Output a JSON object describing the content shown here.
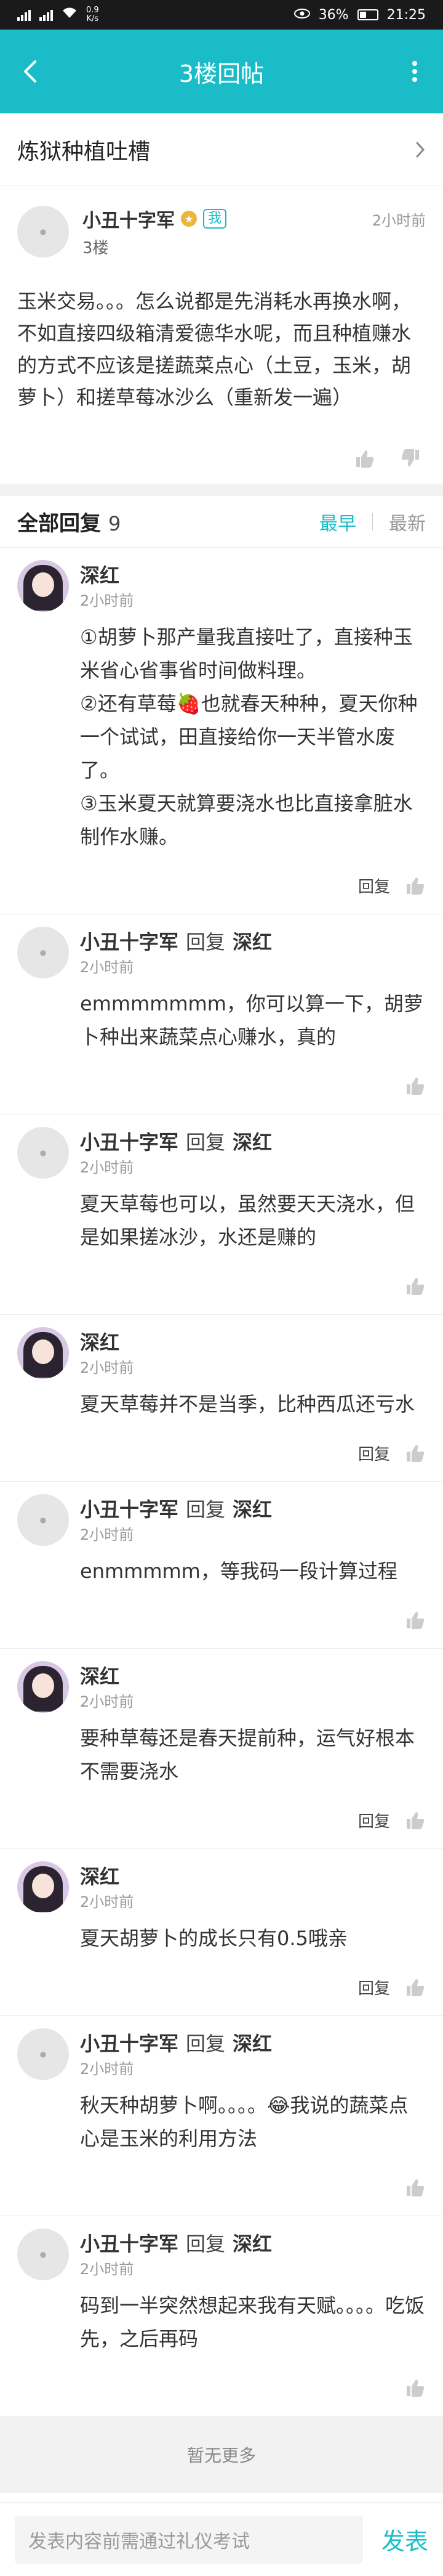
{
  "status_bar": {
    "net_speed": "0.9\nK/s",
    "battery": "36%",
    "time": "21:25"
  },
  "header": {
    "title": "3楼回帖"
  },
  "thread": {
    "title": "炼狱种植吐槽"
  },
  "post": {
    "author": "小丑十字军",
    "badge": "我",
    "time": "2小时前",
    "floor": "3楼",
    "body": "玉米交易。。。怎么说都是先消耗水再换水啊，不如直接四级箱清爱德华水呢，而且种植赚水的方式不应该是搓蔬菜点心（土豆，玉米，胡萝卜）和搓草莓冰沙么（重新发一遍）"
  },
  "replies_header": {
    "label": "全部回复",
    "count": "9",
    "sort_active": "最早",
    "sort_inactive": "最新"
  },
  "replies": [
    {
      "author": "深红",
      "reply_word": "",
      "target": "",
      "time": "2小时前",
      "avatar": "girl",
      "content": "①胡萝卜那产量我直接吐了，直接种玉米省心省事省时间做料理。\n②还有草莓🍓也就春天种种，夏天你种一个试试，田直接给你一天半管水废了。\n③玉米夏天就算要浇水也比直接拿脏水制作水赚。",
      "reply_label": "回复"
    },
    {
      "author": "小丑十字军",
      "reply_word": "回复",
      "target": "深红",
      "time": "2小时前",
      "avatar": "default",
      "content": "emmmmmmm，你可以算一下，胡萝卜种出来蔬菜点心赚水，真的",
      "reply_label": ""
    },
    {
      "author": "小丑十字军",
      "reply_word": "回复",
      "target": "深红",
      "time": "2小时前",
      "avatar": "default",
      "content": "夏天草莓也可以，虽然要天天浇水，但是如果搓冰沙，水还是赚的",
      "reply_label": ""
    },
    {
      "author": "深红",
      "reply_word": "",
      "target": "",
      "time": "2小时前",
      "avatar": "girl",
      "content": "夏天草莓并不是当季，比种西瓜还亏水",
      "reply_label": "回复"
    },
    {
      "author": "小丑十字军",
      "reply_word": "回复",
      "target": "深红",
      "time": "2小时前",
      "avatar": "default",
      "content": "enmmmmm，等我码一段计算过程",
      "reply_label": ""
    },
    {
      "author": "深红",
      "reply_word": "",
      "target": "",
      "time": "2小时前",
      "avatar": "girl",
      "content": "要种草莓还是春天提前种，运气好根本不需要浇水",
      "reply_label": "回复"
    },
    {
      "author": "深红",
      "reply_word": "",
      "target": "",
      "time": "2小时前",
      "avatar": "girl",
      "content": "夏天胡萝卜的成长只有0.5哦亲",
      "reply_label": "回复"
    },
    {
      "author": "小丑十字军",
      "reply_word": "回复",
      "target": "深红",
      "time": "2小时前",
      "avatar": "default",
      "content": "秋天种胡萝卜啊。。。。😂我说的蔬菜点心是玉米的利用方法",
      "reply_label": ""
    },
    {
      "author": "小丑十字军",
      "reply_word": "回复",
      "target": "深红",
      "time": "2小时前",
      "avatar": "default",
      "content": "码到一半突然想起来我有天赋。。。。吃饭先，之后再码",
      "reply_label": ""
    }
  ],
  "footer": {
    "no_more": "暂无更多"
  },
  "composer": {
    "placeholder": "发表内容前需通过礼仪考试",
    "send": "发表"
  },
  "colors": {
    "accent": "#1abdc7"
  }
}
